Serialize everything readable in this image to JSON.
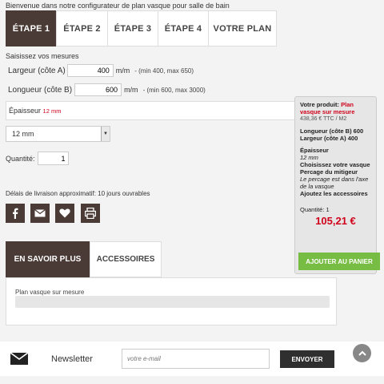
{
  "intro": "Bienvenue dans notre configurateur de plan vasque pour salle de bain",
  "steps": [
    "ÉTAPE 1",
    "ÉTAPE 2",
    "ÉTAPE 3",
    "ÉTAPE 4",
    "VOTRE PLAN"
  ],
  "measures": {
    "title": "Saisissez vos mesures",
    "largeur": {
      "label": "Largeur (côte A)",
      "value": "400",
      "unit": "m/m",
      "hint": "- (min 400, max 650)"
    },
    "longueur": {
      "label": "Longueur (côte B)",
      "value": "600",
      "unit": "m/m",
      "hint": "- (min 600, max 3000)"
    }
  },
  "epaisseur": {
    "label": "Épaisseur",
    "value": "12 mm"
  },
  "select": {
    "selected": "12 mm"
  },
  "quantity": {
    "label": "Quantité:",
    "value": "1"
  },
  "delay": "Délais de livraison approximatif: 10 jours ouvrables",
  "share_icons": [
    "facebook-icon",
    "mail-icon",
    "heart-icon",
    "print-icon"
  ],
  "product": {
    "label": "Votre produit:",
    "name": "Plan vasque sur mesure",
    "price_line": "438,36 € TTC / M2",
    "longueur": "Longueur (côte B) 600",
    "largeur": "Largeur (côte A) 400",
    "epaisseur_label": "Épaisseur",
    "epaisseur_value": "12 mm",
    "choose_vasque": "Choisissez votre vasque",
    "percage": "Percage du mitigeur",
    "percage_note": "Le percage est dans l'axe de la vasque",
    "accessoires": "Ajoutez les accessoires",
    "quantite": "Quantité: 1",
    "price": "105,21 €",
    "cart_button": "AJOUTER AU PANIER"
  },
  "tabs": [
    "EN SAVOIR PLUS",
    "ACCESSOIRES"
  ],
  "tab_content": "Plan vasque sur mesure",
  "newsletter": {
    "label": "Newsletter",
    "placeholder": "votre e-mail",
    "button": "ENVOYER"
  },
  "colors": {
    "accent": "#4a3b36",
    "price": "#d0021b",
    "cart": "#78bd43"
  }
}
